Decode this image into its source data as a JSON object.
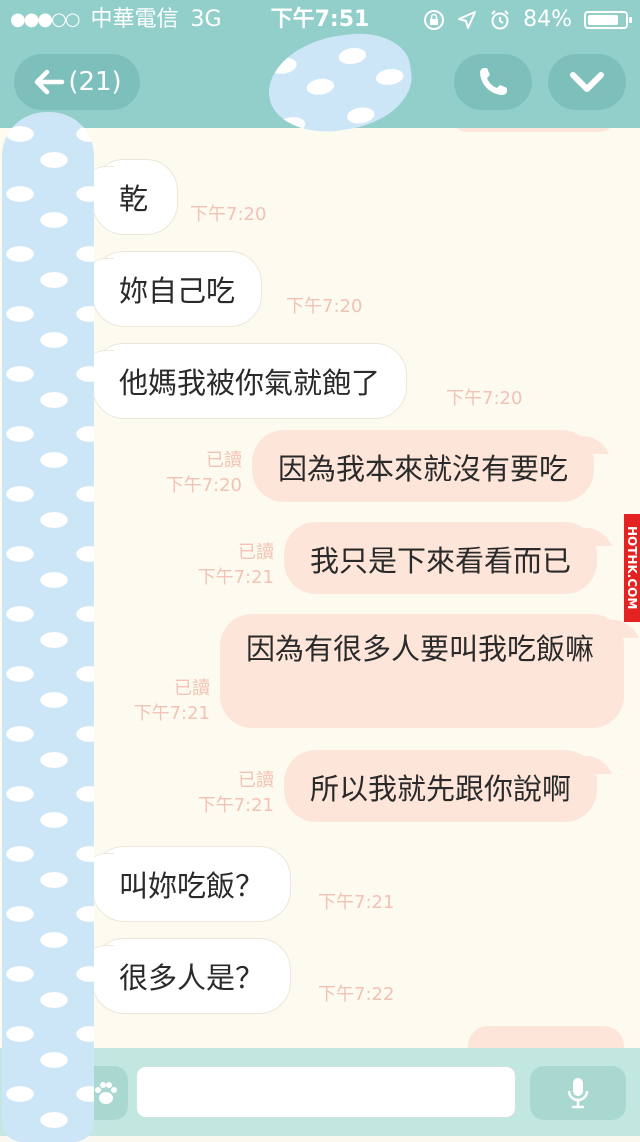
{
  "status_bar": {
    "carrier": "中華電信",
    "network": "3G",
    "time": "下午7:51",
    "battery_percent": "84%",
    "battery_level": 0.84
  },
  "header": {
    "unread_count": "(21)"
  },
  "messages": [
    {
      "text": "乾",
      "time": "下午7:20"
    },
    {
      "text": "妳自己吃",
      "time": "下午7:20"
    },
    {
      "text": "他媽我被你氣就飽了",
      "time": "下午7:20"
    },
    {
      "text": "因為我本來就沒有要吃",
      "read": "已讀",
      "time": "下午7:20"
    },
    {
      "text": "我只是下來看看而已",
      "read": "已讀",
      "time": "下午7:21"
    },
    {
      "text": "因為有很多人要叫我吃飯嘛",
      "read": "已讀",
      "time": "下午7:21"
    },
    {
      "text": "所以我就先跟你說啊",
      "read": "已讀",
      "time": "下午7:21"
    },
    {
      "text": "叫妳吃飯？",
      "time": "下午7:21"
    },
    {
      "text": "很多人是？",
      "time": "下午7:22"
    }
  ],
  "watermark": "HOTHK.COM",
  "input": {
    "placeholder": ""
  },
  "colors": {
    "header": "#92cfca",
    "chat_bg": "#fdfbf0",
    "outgoing_bubble": "#fde5da",
    "incoming_bubble": "#ffffff",
    "timestamp": "#f2c2b5",
    "input_bar": "#c2e6e0"
  },
  "icons": {
    "back": "arrow-left-icon",
    "call": "phone-icon",
    "menu": "chevron-down-icon",
    "sticker": "paw-icon",
    "mic": "microphone-icon"
  }
}
